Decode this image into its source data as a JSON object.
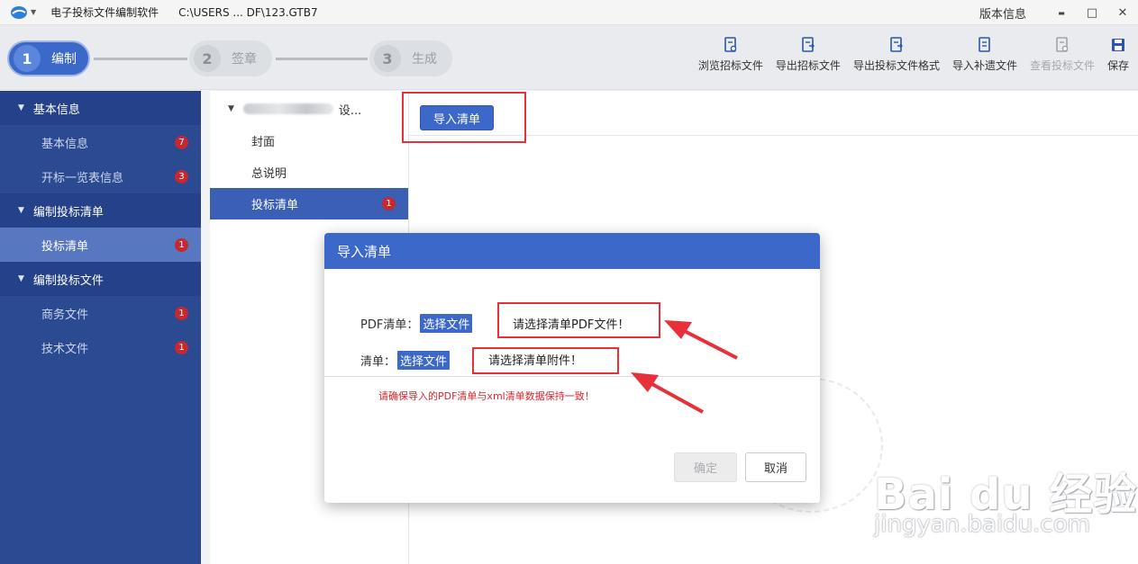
{
  "titlebar": {
    "app_name": "电子投标文件编制软件",
    "file_path": "C:\\USERS         ...            DF\\123.GTB7",
    "version_info": "版本信息",
    "minimize": "▬",
    "maximize": "□",
    "close": "✕"
  },
  "steps": [
    {
      "num": "1",
      "label": "编制"
    },
    {
      "num": "2",
      "label": "签章"
    },
    {
      "num": "3",
      "label": "生成"
    }
  ],
  "tools": [
    {
      "label": "浏览招标文件",
      "icon": "browse-doc-icon"
    },
    {
      "label": "导出招标文件",
      "icon": "export-doc-icon"
    },
    {
      "label": "导出投标文件格式",
      "icon": "export-format-icon"
    },
    {
      "label": "导入补遗文件",
      "icon": "import-addendum-icon"
    },
    {
      "label": "查看投标文件",
      "icon": "view-bid-icon"
    },
    {
      "label": "保存",
      "icon": "save-icon"
    }
  ],
  "sidebar": {
    "groups": [
      {
        "label": "基本信息",
        "items": [
          {
            "label": "基本信息",
            "badge": "7"
          },
          {
            "label": "开标一览表信息",
            "badge": "3"
          }
        ]
      },
      {
        "label": "编制投标清单",
        "items": [
          {
            "label": "投标清单",
            "badge": "1"
          }
        ]
      },
      {
        "label": "编制投标文件",
        "items": [
          {
            "label": "商务文件",
            "badge": "1"
          },
          {
            "label": "技术文件",
            "badge": "1"
          }
        ]
      }
    ]
  },
  "tree": {
    "root_suffix": "设...",
    "items": [
      {
        "label": "封面"
      },
      {
        "label": "总说明"
      },
      {
        "label": "投标清单",
        "badge": "1"
      }
    ]
  },
  "content": {
    "import_button": "导入清单"
  },
  "modal": {
    "title": "导入清单",
    "pdf_label": "PDF清单：",
    "pdf_button": "选择文件",
    "pdf_hint": "请选择清单PDF文件！",
    "list_label": "清单：",
    "list_button": "选择文件",
    "list_hint": "请选择清单附件！",
    "warning": "请确保导入的PDF清单与xml清单数据保持一致！",
    "ok": "确定",
    "cancel": "取消"
  },
  "watermark": {
    "text": "Bai du 经验",
    "url": "jingyan.baidu.com"
  },
  "colors": {
    "accent": "#3b68c9",
    "sidebar": "#2b4a92",
    "annotation_red": "#e8303a",
    "badge_red": "#c7272f"
  }
}
